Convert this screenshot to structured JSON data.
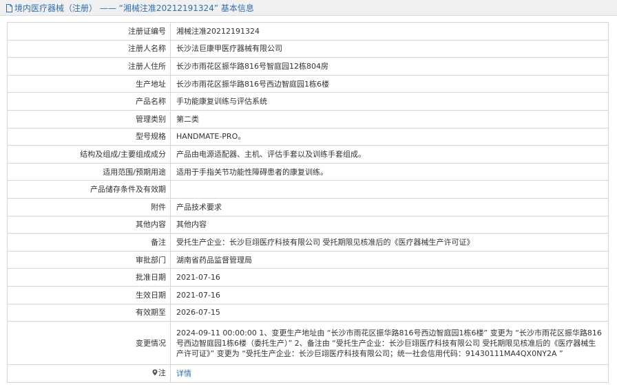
{
  "header": {
    "title": "境内医疗器械（注册） —— “湘械注准20212191324” 基本信息"
  },
  "rows": [
    {
      "label": "注册证编号",
      "value": "湘械注准20212191324"
    },
    {
      "label": "注册人名称",
      "value": "长沙法巨康甲医疗器械有限公司"
    },
    {
      "label": "注册人住所",
      "value": "长沙市雨花区振华路816号智庭园12栋804房"
    },
    {
      "label": "生产地址",
      "value": "长沙市雨花区振华路816号西边智庭园1栋6楼"
    },
    {
      "label": "产品名称",
      "value": "手功能康复训练与评估系统"
    },
    {
      "label": "管理类别",
      "value": "第二类"
    },
    {
      "label": "型号规格",
      "value": "HANDMATE-PRO。"
    },
    {
      "label": "结构及组成/主要组成成分",
      "value": "产品由电源适配器、主机、评估手套以及训练手套组成。"
    },
    {
      "label": "适用范围/预期用途",
      "value": "适用于手指关节功能性障碍患者的康复训练。"
    },
    {
      "label": "产品储存条件及有效期",
      "value": ""
    },
    {
      "label": "附件",
      "value": "产品技术要求"
    },
    {
      "label": "其他内容",
      "value": "其他内容"
    },
    {
      "label": "备注",
      "value": "受托生产企业：长沙巨翊医疗科技有限公司 受托期限见核准后的《医疗器械生产许可证》"
    },
    {
      "label": "审批部门",
      "value": "湖南省药品监督管理局"
    },
    {
      "label": "批准日期",
      "value": "2021-07-16"
    },
    {
      "label": "生效日期",
      "value": "2021-07-16"
    },
    {
      "label": "有效期至",
      "value": "2026-07-15"
    },
    {
      "label": "变更情况",
      "value": "2024-09-11 00:00:00 1、变更生产地址由 “长沙市雨花区振华路816号西边智庭园1栋6楼” 变更为 “长沙市雨花区振华路816号西边智庭园1栋6楼（委托生产）” 2、备注由 “受托生产企业：长沙巨翊医疗科技有限公司 受托期限见核准后的《医疗器械生产许可证》” 变更为 “受托生产企业：长沙巨翊医疗科技有限公司；统一社会信用代码：91430111MA4QX0NY2A ”"
    },
    {
      "label": "注",
      "value": "详情"
    }
  ]
}
